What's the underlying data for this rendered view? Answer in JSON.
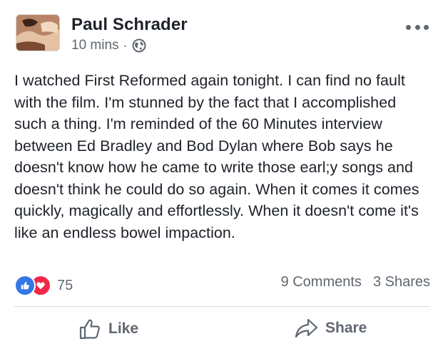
{
  "post": {
    "author": "Paul Schrader",
    "time": "10 mins",
    "separator": "·",
    "privacy_icon": "globe-icon",
    "menu_icon": "more-options-icon",
    "text": "I watched First Reformed again tonight. I can find no fault with the film. I'm stunned by the fact that I accomplished such a thing. I'm reminded of the 60 Minutes interview between Ed Bradley and Bod Dylan where Bob says he doesn't know how he came to write those earl;y songs and doesn't think he could do so again. When it comes it comes quickly, magically and effortlessly. When it doesn't come it's like an endless bowel impaction."
  },
  "stats": {
    "reaction_icons": [
      "like-reaction-icon",
      "love-reaction-icon"
    ],
    "reaction_count": "75",
    "comments": "9 Comments",
    "shares": "3 Shares"
  },
  "actions": {
    "like_label": "Like",
    "share_label": "Share"
  },
  "colors": {
    "like_blue": "#3578e5",
    "love_red": "#f0284a",
    "secondary_text": "#606770",
    "primary_text": "#1d2129",
    "divider": "#dadde1"
  }
}
